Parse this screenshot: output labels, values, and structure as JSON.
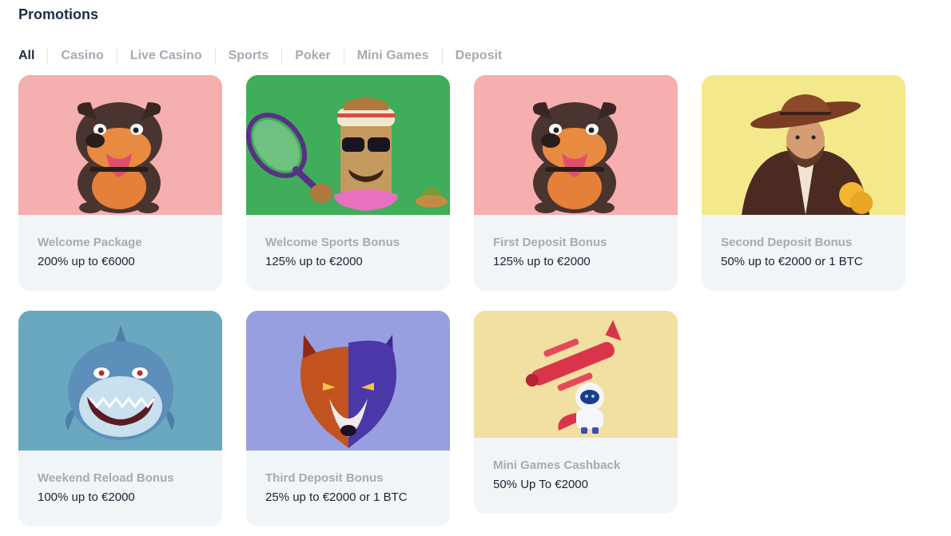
{
  "page": {
    "title": "Promotions"
  },
  "tabs": [
    {
      "label": "All",
      "active": true
    },
    {
      "label": "Casino",
      "active": false
    },
    {
      "label": "Live Casino",
      "active": false
    },
    {
      "label": "Sports",
      "active": false
    },
    {
      "label": "Poker",
      "active": false
    },
    {
      "label": "Mini Games",
      "active": false
    },
    {
      "label": "Deposit",
      "active": false
    }
  ],
  "promotions": [
    {
      "name": "Welcome Package",
      "offer": "200% up to €6000",
      "bg": "#f5afae",
      "art": "dog-icon"
    },
    {
      "name": "Welcome Sports Bonus",
      "offer": "125% up to €2000",
      "bg": "#3fad59",
      "art": "tiki-tennis-icon"
    },
    {
      "name": "First Deposit Bonus",
      "offer": "125% up to €2000",
      "bg": "#f5afae",
      "art": "dog-icon"
    },
    {
      "name": "Second Deposit Bonus",
      "offer": "50% up to €2000 or 1 BTC",
      "bg": "#f4e98a",
      "art": "cowboy-icon"
    },
    {
      "name": "Weekend Reload Bonus",
      "offer": "100% up to €2000",
      "bg": "#6aa8bf",
      "art": "shark-icon"
    },
    {
      "name": "Third Deposit Bonus",
      "offer": "25% up to €2000 or 1 BTC",
      "bg": "#979fe0",
      "art": "wolf-icon"
    },
    {
      "name": "Mini Games Cashback",
      "offer": "50% Up To €2000",
      "bg": "#f2e0a3",
      "art": "plane-astronaut-icon"
    }
  ]
}
